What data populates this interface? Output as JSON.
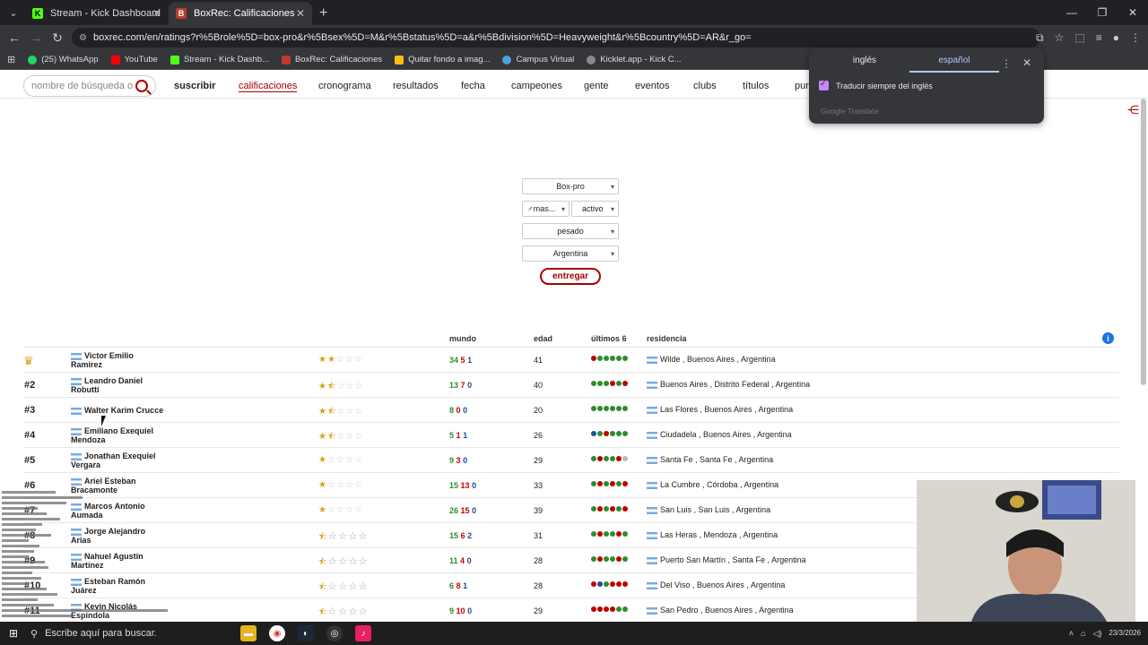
{
  "browser": {
    "tabs": [
      {
        "title": "Stream - Kick Dashboard",
        "active": false
      },
      {
        "title": "BoxRec: Calificaciones",
        "active": true
      }
    ],
    "url": "boxrec.com/en/ratings?r%5Brole%5D=box-pro&r%5Bsex%5D=M&r%5Bstatus%5D=a&r%5Bdivision%5D=Heavyweight&r%5Bcountry%5D=AR&r_go=",
    "bookmarks": [
      "(25) WhatsApp",
      "YouTube",
      "Stream - Kick Dashb...",
      "BoxRec: Calificaciones",
      "Quitar fondo a imag...",
      "Campus Virtual",
      "Kicklet.app - Kick C..."
    ]
  },
  "site_nav": {
    "search_placeholder": "nombre de búsqueda o",
    "items": [
      "suscribir",
      "calificaciones",
      "cronograma",
      "resultados",
      "fecha",
      "campeones",
      "gente",
      "eventos",
      "clubs",
      "títulos",
      "pun"
    ]
  },
  "translate_popup": {
    "tab_source": "inglés",
    "tab_target": "español",
    "checkbox_label": "Traducir siempre del inglés",
    "footer": "Google Translate"
  },
  "filters": {
    "role": "Box-pro",
    "sex": "♂mas...",
    "status": "activo",
    "division": "pesado",
    "country": "Argentina",
    "submit_label": "entregar"
  },
  "table": {
    "headers": {
      "world": "mundo",
      "age": "edad",
      "last6": "últimos 6",
      "residence": "residencia"
    },
    "info_icon": "i",
    "colors": {
      "win": "#2e8b2e",
      "loss": "#c00000",
      "draw": "#1a4fa0",
      "star": "#d4a017"
    },
    "rows": [
      {
        "rank": "crown",
        "name1": "Victor Emilio",
        "name2": "Ramirez",
        "stars": 2,
        "w": "34",
        "l": "5",
        "d": "1",
        "age": "41",
        "last6": [
          "l",
          "w",
          "w",
          "w",
          "w",
          "w"
        ],
        "residence": "Wilde , Buenos Aires , Argentina"
      },
      {
        "rank": "#2",
        "name1": "Leandro Daniel",
        "name2": "Robutti",
        "stars": 1.5,
        "w": "13",
        "l": "7",
        "d": "0",
        "age": "40",
        "last6": [
          "w",
          "w",
          "w",
          "l",
          "w",
          "l"
        ],
        "residence": "Buenos Aires , Distrito Federal , Argentina"
      },
      {
        "rank": "#3",
        "name1": "Walter Karim Crucce",
        "name2": "",
        "stars": 1.5,
        "w": "8",
        "l": "0",
        "d": "0",
        "age": "20",
        "last6": [
          "w",
          "w",
          "w",
          "w",
          "w",
          "w"
        ],
        "residence": "Las Flores , Buenos Aires , Argentina"
      },
      {
        "rank": "#4",
        "name1": "Emiliano Exequiel",
        "name2": "Mendoza",
        "stars": 1.5,
        "w": "5",
        "l": "1",
        "d": "1",
        "age": "26",
        "last6": [
          "d",
          "w",
          "l",
          "w",
          "w",
          "w"
        ],
        "residence": "Ciudadela , Buenos Aires , Argentina"
      },
      {
        "rank": "#5",
        "name1": "Jonathan Exequiel",
        "name2": "Vergara",
        "stars": 1,
        "w": "9",
        "l": "3",
        "d": "0",
        "age": "29",
        "last6": [
          "w",
          "l",
          "w",
          "w",
          "l",
          "n"
        ],
        "residence": "Santa Fe , Santa Fe , Argentina"
      },
      {
        "rank": "#6",
        "name1": "Ariel Esteban",
        "name2": "Bracamonte",
        "stars": 1,
        "w": "15",
        "l": "13",
        "d": "0",
        "age": "33",
        "last6": [
          "w",
          "l",
          "w",
          "l",
          "w",
          "l"
        ],
        "residence": "La Cumbre , Córdoba , Argentina"
      },
      {
        "rank": "#7",
        "name1": "Marcos Antonio",
        "name2": "Aumada",
        "stars": 1,
        "w": "26",
        "l": "15",
        "d": "0",
        "age": "39",
        "last6": [
          "w",
          "l",
          "w",
          "l",
          "w",
          "l"
        ],
        "residence": "San Luis , San Luis , Argentina"
      },
      {
        "rank": "#8",
        "name1": "Jorge Alejandro",
        "name2": "Arias",
        "stars": 0.5,
        "w": "15",
        "l": "6",
        "d": "2",
        "age": "31",
        "last6": [
          "w",
          "l",
          "w",
          "w",
          "l",
          "w"
        ],
        "residence": "Las Heras , Mendoza , Argentina"
      },
      {
        "rank": "#9",
        "name1": "Nahuel Agustín",
        "name2": "Martínez",
        "stars": 0.5,
        "w": "11",
        "l": "4",
        "d": "0",
        "age": "28",
        "last6": [
          "w",
          "l",
          "w",
          "w",
          "l",
          "w"
        ],
        "residence": "Puerto San Martín , Santa Fe , Argentina"
      },
      {
        "rank": "#10",
        "name1": "Esteban Ramón",
        "name2": "Juárez",
        "stars": 0.5,
        "w": "6",
        "l": "8",
        "d": "1",
        "age": "28",
        "last6": [
          "l",
          "d",
          "w",
          "l",
          "l",
          "l"
        ],
        "residence": "Del Viso , Buenos Aires , Argentina"
      },
      {
        "rank": "#11",
        "name1": "Kevin Nicolás",
        "name2": "Espindola",
        "stars": 0.5,
        "w": "9",
        "l": "10",
        "d": "0",
        "age": "29",
        "last6": [
          "l",
          "l",
          "l",
          "l",
          "w",
          "w"
        ],
        "residence": "San Pedro , Buenos Aires , Argentina"
      }
    ]
  },
  "taskbar": {
    "search_text": "Escribe aquí para buscar.",
    "date": "23/3/2026"
  }
}
